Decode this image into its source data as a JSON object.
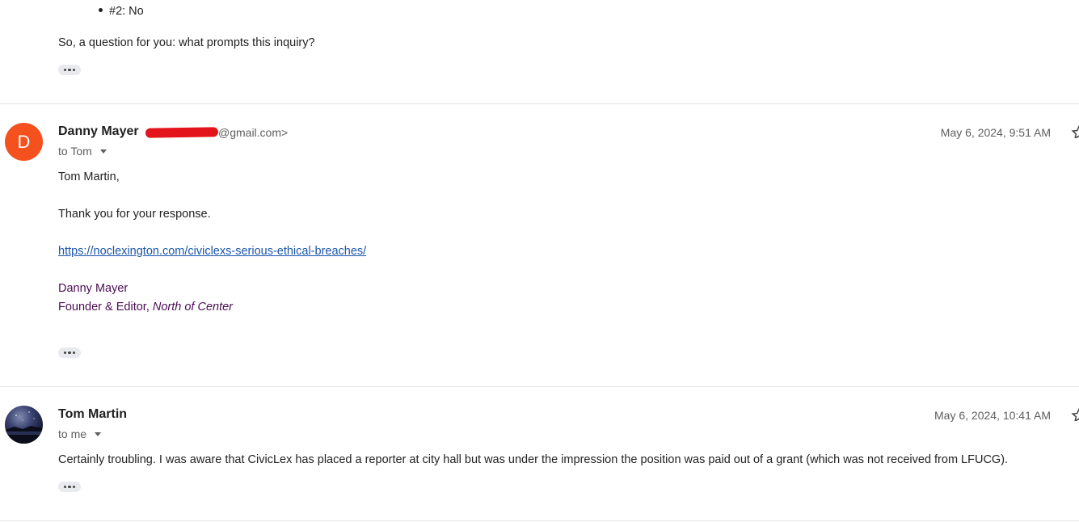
{
  "message1": {
    "bullet": "#2: No",
    "text": "So, a question for you: what prompts this inquiry?"
  },
  "message2": {
    "avatar_letter": "D",
    "sender_name": "Danny Mayer",
    "sender_email_suffix": "@gmail.com>",
    "to": "to Tom",
    "date": "May 6, 2024, 9:51 AM",
    "greeting": "Tom Martin,",
    "body": "Thank you for your response.",
    "link": "https://noclexington.com/civiclexs-serious-ethical-breaches/",
    "signature_name": "Danny Mayer",
    "signature_title": "Founder & Editor, ",
    "signature_org": "North of Center"
  },
  "message3": {
    "sender_name": "Tom Martin",
    "to": "to me",
    "date": "May 6, 2024, 10:41 AM",
    "body": "Certainly troubling. I was aware that CivicLex has placed a reporter at city hall but was under the impression the position was paid out of a grant (which was not received from LFUCG)."
  },
  "colors": {
    "avatar_bg": "#f4511e",
    "link": "#1a56a8",
    "signature": "#4a0d52",
    "redaction": "#e3141b"
  },
  "icons": [
    "more-icon",
    "star-icon",
    "chevron-down-icon"
  ]
}
